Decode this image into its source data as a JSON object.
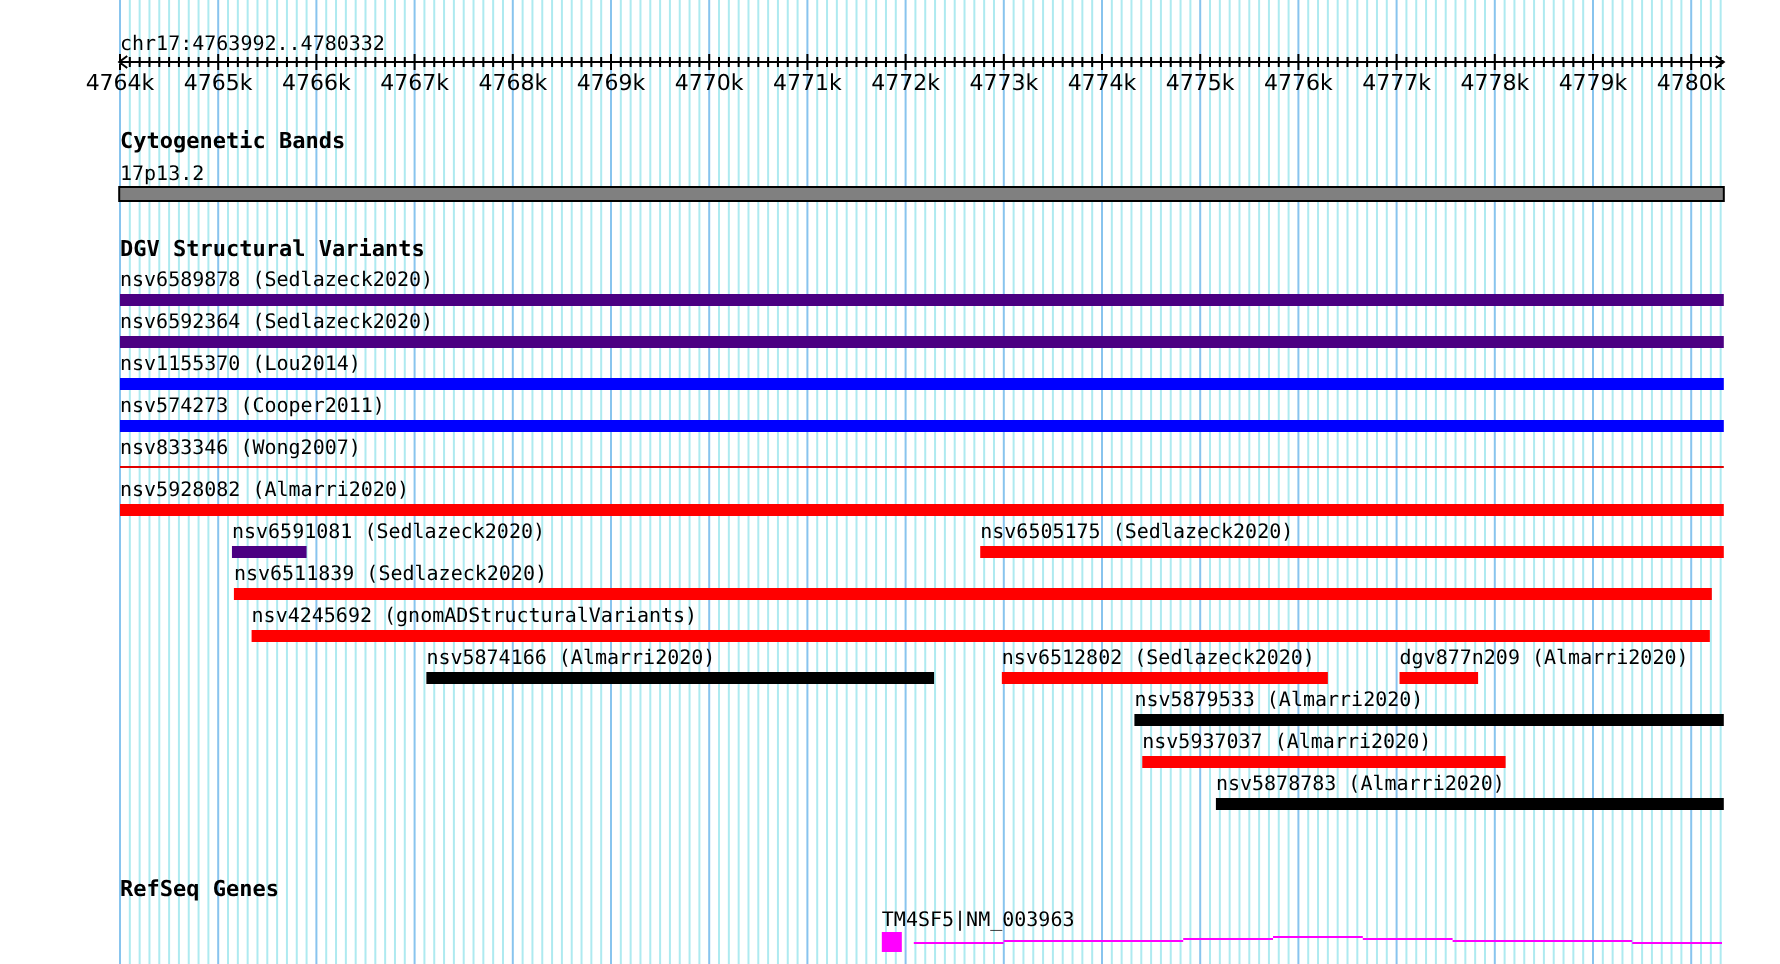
{
  "ruler": {
    "label": "chr17:4763992..4780332",
    "ticks": [
      "4764k",
      "4765k",
      "4766k",
      "4767k",
      "4768k",
      "4769k",
      "4770k",
      "4771k",
      "4772k",
      "4773k",
      "4774k",
      "4775k",
      "4776k",
      "4777k",
      "4778k",
      "4779k",
      "4780k"
    ]
  },
  "tracks": [
    {
      "kind": "bands",
      "title": "Cytogenetic Bands",
      "features": [
        {
          "label": "17p13.2",
          "color": "#808080"
        }
      ]
    },
    {
      "kind": "variants",
      "title": "DGV Structural Variants",
      "rows": [
        [
          {
            "label": "nsv6589878 (Sedlazeck2020)",
            "color": "#4b0082",
            "kind": "bar"
          }
        ],
        [
          {
            "label": "nsv6592364 (Sedlazeck2020)",
            "color": "#4b0082",
            "kind": "bar"
          }
        ],
        [
          {
            "label": "nsv1155370 (Lou2014)",
            "color": "#0000ff",
            "kind": "bar"
          }
        ],
        [
          {
            "label": "nsv574273 (Cooper2011)",
            "color": "#0000ff",
            "kind": "bar"
          }
        ],
        [
          {
            "label": "nsv833346 (Wong2007)",
            "color": "#e00000",
            "kind": "line"
          }
        ],
        [
          {
            "label": "nsv5928082 (Almarri2020)",
            "color": "#ff0000",
            "kind": "bar"
          }
        ],
        [
          {
            "label": "nsv6591081 (Sedlazeck2020)",
            "color": "#4b0082",
            "kind": "bar"
          },
          {
            "label": "nsv6505175 (Sedlazeck2020)",
            "color": "#ff0000",
            "kind": "bar"
          }
        ],
        [
          {
            "label": "nsv6511839 (Sedlazeck2020)",
            "color": "#ff0000",
            "kind": "bar"
          }
        ],
        [
          {
            "label": "nsv4245692 (gnomADStructuralVariants)",
            "color": "#ff0000",
            "kind": "bar"
          }
        ],
        [
          {
            "label": "nsv5874166 (Almarri2020)",
            "color": "#000000",
            "kind": "bar"
          },
          {
            "label": "nsv6512802 (Sedlazeck2020)",
            "color": "#ff0000",
            "kind": "bar"
          },
          {
            "label": "dgv877n209 (Almarri2020)",
            "color": "#ff0000",
            "kind": "bar"
          }
        ],
        [
          {
            "label": "nsv5879533 (Almarri2020)",
            "color": "#000000",
            "kind": "bar"
          }
        ],
        [
          {
            "label": "nsv5937037 (Almarri2020)",
            "color": "#ff0000",
            "kind": "bar"
          }
        ],
        [
          {
            "label": "nsv5878783 (Almarri2020)",
            "color": "#000000",
            "kind": "bar"
          }
        ]
      ]
    },
    {
      "kind": "genes",
      "title": "RefSeq Genes",
      "features": [
        {
          "label": "TM4SF5|NM_003963",
          "color": "#ff00ff"
        }
      ]
    }
  ]
}
